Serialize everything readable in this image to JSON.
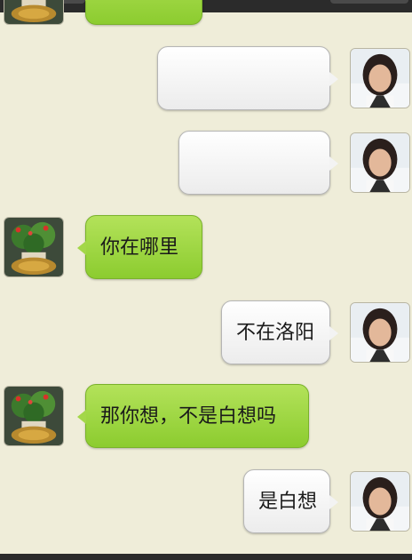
{
  "messages": [
    {
      "direction": "out",
      "text": "",
      "avatar": "female-avatar-icon"
    },
    {
      "direction": "out",
      "text": "",
      "avatar": "female-avatar-icon"
    },
    {
      "direction": "in",
      "text": "你在哪里",
      "avatar": "plant-avatar-icon"
    },
    {
      "direction": "out",
      "text": "不在洛阳",
      "avatar": "female-avatar-icon"
    },
    {
      "direction": "in",
      "text": "那你想，不是白想吗",
      "avatar": "plant-avatar-icon"
    },
    {
      "direction": "out",
      "text": "是白想",
      "avatar": "female-avatar-icon"
    }
  ],
  "colors": {
    "background": "#efedd9",
    "incoming_bubble": "#9bd53f",
    "outgoing_bubble": "#f5f5f5"
  }
}
